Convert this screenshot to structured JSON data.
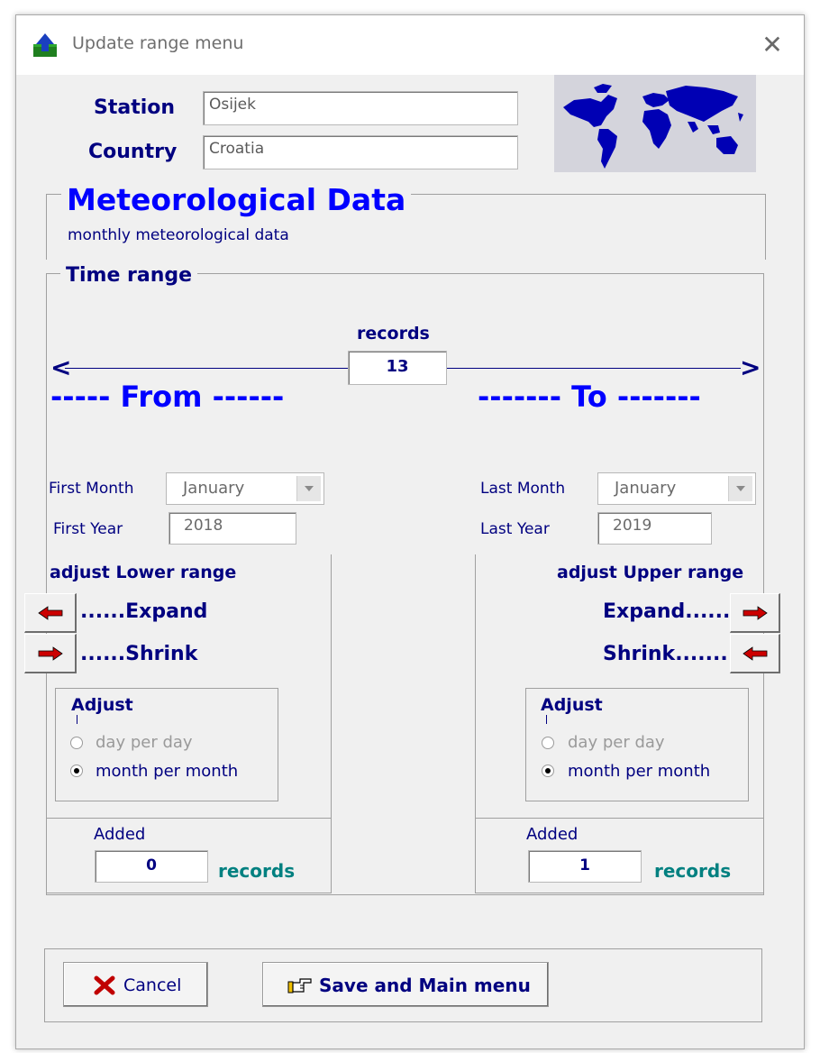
{
  "window": {
    "title": "Update range menu"
  },
  "station": {
    "label": "Station",
    "value": "Osijek"
  },
  "country": {
    "label": "Country",
    "value": "Croatia"
  },
  "met": {
    "title": "Meteorological Data",
    "subtitle": "monthly meteorological data"
  },
  "time_range": {
    "title": "Time range",
    "records_label": "records",
    "records_value": "13",
    "left_arrow": "<",
    "right_arrow": ">",
    "from_label": "----- From ------",
    "to_label": "------- To -------"
  },
  "lower": {
    "month_label": "First Month",
    "month_value": "January",
    "year_label": "First Year",
    "year_value": "2018",
    "adjust_title": "adjust Lower range",
    "expand": "......Expand",
    "shrink": "......Shrink",
    "adjust_box_title": "Adjust",
    "opt_day": "day per day",
    "opt_month": "month per month",
    "added_label": "Added",
    "added_value": "0",
    "records_label": "records"
  },
  "upper": {
    "month_label": "Last Month",
    "month_value": "January",
    "year_label": "Last Year",
    "year_value": "2019",
    "adjust_title": "adjust Upper range",
    "expand": "Expand......",
    "shrink": "Shrink........",
    "adjust_box_title": "Adjust",
    "opt_day": "day per day",
    "opt_month": "month per month",
    "added_label": "Added",
    "added_value": "1",
    "records_label": "records"
  },
  "buttons": {
    "cancel": "Cancel",
    "save": "Save and Main menu"
  },
  "colors": {
    "accent": "#0000ff",
    "navy": "#000080",
    "teal": "#008080",
    "arrow_red": "#cc0000",
    "map_blue": "#0000b4"
  },
  "icons": [
    "app-upload-icon",
    "close-icon",
    "world-map-icon",
    "left-arrow-icon",
    "right-arrow-icon",
    "cancel-x-icon",
    "pointing-hand-icon"
  ]
}
